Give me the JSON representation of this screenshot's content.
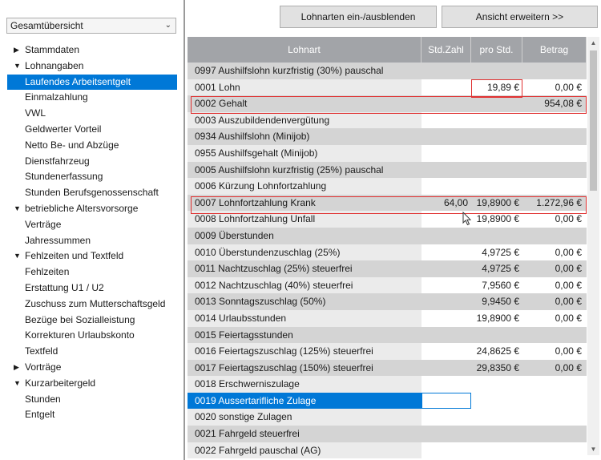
{
  "view_select": {
    "value": "Gesamtübersicht"
  },
  "tree": [
    {
      "label": "Stammdaten",
      "level": 0,
      "arrow": "right"
    },
    {
      "label": "Lohnangaben",
      "level": 0,
      "arrow": "down"
    },
    {
      "label": "Laufendes Arbeitsentgelt",
      "level": 1,
      "selected": true
    },
    {
      "label": "Einmalzahlung",
      "level": 1
    },
    {
      "label": "VWL",
      "level": 1
    },
    {
      "label": "Geldwerter Vorteil",
      "level": 1
    },
    {
      "label": "Netto Be- und Abzüge",
      "level": 1
    },
    {
      "label": "Dienstfahrzeug",
      "level": 1
    },
    {
      "label": "Stundenerfassung",
      "level": 1
    },
    {
      "label": "Stunden Berufsgenossenschaft",
      "level": 1
    },
    {
      "label": "betriebliche Altersvorsorge",
      "level": 0,
      "arrow": "down"
    },
    {
      "label": "Verträge",
      "level": 1
    },
    {
      "label": "Jahressummen",
      "level": 1
    },
    {
      "label": "Fehlzeiten und Textfeld",
      "level": 0,
      "arrow": "down"
    },
    {
      "label": "Fehlzeiten",
      "level": 1
    },
    {
      "label": "Erstattung U1 / U2",
      "level": 1
    },
    {
      "label": "Zuschuss zum Mutterschaftsgeld",
      "level": 1
    },
    {
      "label": "Bezüge bei Sozialleistung",
      "level": 1
    },
    {
      "label": "Korrekturen Urlaubskonto",
      "level": 1
    },
    {
      "label": "Textfeld",
      "level": 1
    },
    {
      "label": "Vorträge",
      "level": 0,
      "arrow": "right"
    },
    {
      "label": "Kurzarbeitergeld",
      "level": 0,
      "arrow": "down"
    },
    {
      "label": "Stunden",
      "level": 1
    },
    {
      "label": "Entgelt",
      "level": 1
    }
  ],
  "toolbar": {
    "toggle_label": "Lohnarten ein-/ausblenden",
    "expand_label": "Ansicht erweitern >>"
  },
  "table": {
    "headers": [
      "Lohnart",
      "Std.Zahl",
      "pro Std.",
      "Betrag"
    ],
    "rows": [
      {
        "name": "0997 Aushilfslohn kurzfristig (30%) pauschal",
        "std": "",
        "pro": "",
        "bet": ""
      },
      {
        "name": "0001 Lohn",
        "std": "",
        "pro": "19,89 €",
        "bet": "0,00 €"
      },
      {
        "name": "0002 Gehalt",
        "std": "",
        "pro": "",
        "bet": "954,08 €"
      },
      {
        "name": "0003 Auszubildendenvergütung",
        "std": "",
        "pro": "",
        "bet": ""
      },
      {
        "name": "0934 Aushilfslohn (Minijob)",
        "std": "",
        "pro": "",
        "bet": ""
      },
      {
        "name": "0955 Aushilfsgehalt (Minijob)",
        "std": "",
        "pro": "",
        "bet": ""
      },
      {
        "name": "0005 Aushilfslohn kurzfristig (25%) pauschal",
        "std": "",
        "pro": "",
        "bet": ""
      },
      {
        "name": "0006 Kürzung Lohnfortzahlung",
        "std": "",
        "pro": "",
        "bet": ""
      },
      {
        "name": "0007 Lohnfortzahlung Krank",
        "std": "64,00",
        "pro": "19,8900 €",
        "bet": "1.272,96 €"
      },
      {
        "name": "0008 Lohnfortzahlung Unfall",
        "std": "",
        "pro": "19,8900 €",
        "bet": "0,00 €"
      },
      {
        "name": "0009 Überstunden",
        "std": "",
        "pro": "",
        "bet": ""
      },
      {
        "name": "0010 Überstundenzuschlag (25%)",
        "std": "",
        "pro": "4,9725 €",
        "bet": "0,00 €"
      },
      {
        "name": "0011 Nachtzuschlag (25%) steuerfrei",
        "std": "",
        "pro": "4,9725 €",
        "bet": "0,00 €"
      },
      {
        "name": "0012 Nachtzuschlag (40%) steuerfrei",
        "std": "",
        "pro": "7,9560 €",
        "bet": "0,00 €"
      },
      {
        "name": "0013 Sonntagszuschlag (50%)",
        "std": "",
        "pro": "9,9450 €",
        "bet": "0,00 €"
      },
      {
        "name": "0014 Urlaubsstunden",
        "std": "",
        "pro": "19,8900 €",
        "bet": "0,00 €"
      },
      {
        "name": "0015 Feiertagsstunden",
        "std": "",
        "pro": "",
        "bet": ""
      },
      {
        "name": "0016 Feiertagszuschlag (125%) steuerfrei",
        "std": "",
        "pro": "24,8625 €",
        "bet": "0,00 €"
      },
      {
        "name": "0017 Feiertagszuschlag (150%) steuerfrei",
        "std": "",
        "pro": "29,8350 €",
        "bet": "0,00 €"
      },
      {
        "name": "0018 Erschwerniszulage",
        "std": "",
        "pro": "",
        "bet": ""
      },
      {
        "name": "0019 Aussertarifliche Zulage",
        "std": "",
        "pro": "",
        "bet": "",
        "selected": true
      },
      {
        "name": "0020 sonstige Zulagen",
        "std": "",
        "pro": "",
        "bet": ""
      },
      {
        "name": "0021 Fahrgeld steuerfrei",
        "std": "",
        "pro": "",
        "bet": ""
      },
      {
        "name": "0022 Fahrgeld pauschal (AG)",
        "std": "",
        "pro": "",
        "bet": ""
      }
    ]
  },
  "colors": {
    "accent": "#0078d7",
    "highlight": "#e03030",
    "header": "#a2a4a8"
  }
}
